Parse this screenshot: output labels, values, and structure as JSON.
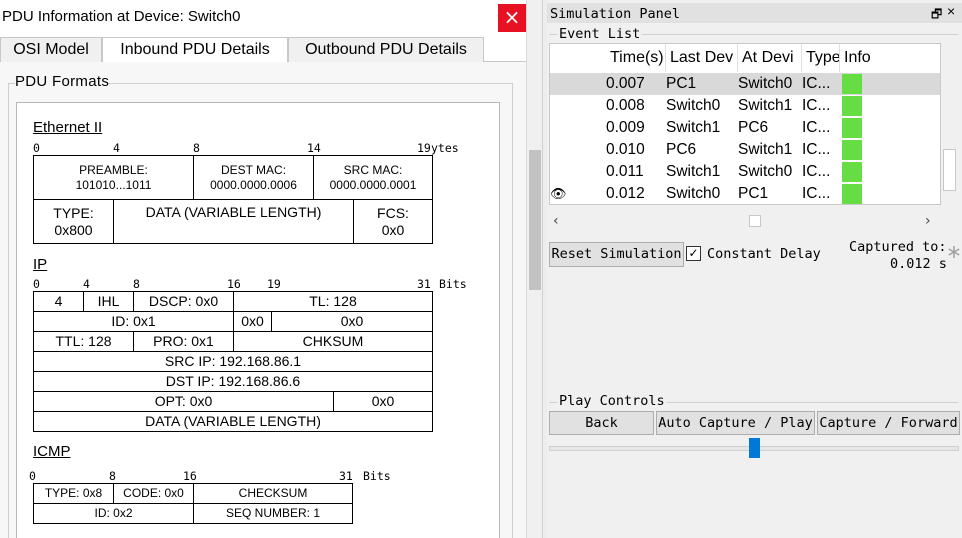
{
  "pdu_window": {
    "title": "PDU Information at Device: Switch0",
    "close_glyph": "×",
    "tabs": [
      "OSI Model",
      "Inbound PDU Details",
      "Outbound PDU Details"
    ],
    "active_tab": "Inbound PDU Details",
    "fieldset_legend": "PDU Formats"
  },
  "ethernet": {
    "title": "Ethernet II",
    "ticks": [
      "0",
      "4",
      "8",
      "14",
      "19"
    ],
    "unit": "ytes",
    "preamble_label": "PREAMBLE:",
    "preamble_value": "101010...1011",
    "dest_mac_label": "DEST MAC:",
    "dest_mac_value": "0000.0000.0006",
    "src_mac_label": "SRC MAC:",
    "src_mac_value": "0000.0000.0001",
    "type_label": "TYPE:",
    "type_value": "0x800",
    "data": "DATA (VARIABLE LENGTH)",
    "fcs_label": "FCS:",
    "fcs_value": "0x0"
  },
  "ip": {
    "title": "IP",
    "ticks": [
      "0",
      "4",
      "8",
      "16",
      "19",
      "31"
    ],
    "unit": "Bits",
    "version": "4",
    "ihl": "IHL",
    "dscp": "DSCP: 0x0",
    "tl": "TL: 128",
    "id": "ID: 0x1",
    "flags": "0x0",
    "frag": "0x0",
    "ttl": "TTL: 128",
    "pro": "PRO: 0x1",
    "chksum": "CHKSUM",
    "src_ip": "SRC IP: 192.168.86.1",
    "dst_ip": "DST IP: 192.168.86.6",
    "opt": "OPT: 0x0",
    "opt2": "0x0",
    "data": "DATA (VARIABLE LENGTH)"
  },
  "icmp": {
    "title": "ICMP",
    "ticks": [
      "0",
      "8",
      "16",
      "31"
    ],
    "unit": "Bits",
    "type": "TYPE: 0x8",
    "code": "CODE: 0x0",
    "checksum": "CHECKSUM",
    "id": "ID: 0x2",
    "seq": "SEQ NUMBER: 1"
  },
  "sim_panel": {
    "title": "Simulation Panel",
    "float_icon": "🗗",
    "close_icon": "×",
    "event_list_legend": "Event List",
    "columns": [
      "Time(s)",
      "Last Dev",
      "At Devi",
      "Type",
      "Info"
    ],
    "events": [
      {
        "time": "0.007",
        "last": "PC1",
        "at": "Switch0",
        "type": "IC...",
        "color": "#66dd44"
      },
      {
        "time": "0.008",
        "last": "Switch0",
        "at": "Switch1",
        "type": "IC...",
        "color": "#66dd44"
      },
      {
        "time": "0.009",
        "last": "Switch1",
        "at": "PC6",
        "type": "IC...",
        "color": "#66dd44"
      },
      {
        "time": "0.010",
        "last": "PC6",
        "at": "Switch1",
        "type": "IC...",
        "color": "#66dd44"
      },
      {
        "time": "0.011",
        "last": "Switch1",
        "at": "Switch0",
        "type": "IC...",
        "color": "#66dd44"
      },
      {
        "time": "0.012",
        "last": "Switch0",
        "at": "PC1",
        "type": "IC...",
        "color": "#66dd44"
      }
    ],
    "eye_glyph": "👁",
    "reset_label": "Reset Simulation",
    "constant_delay_label": "Constant Delay",
    "constant_delay_checked": "✓",
    "captured_label": "Captured to:",
    "captured_value": "0.012 s",
    "play_controls_legend": "Play Controls",
    "back_label": "Back",
    "auto_capture_label": "Auto Capture / Play",
    "capture_forward_label": "Capture / Forward",
    "accent": "#0078d7"
  }
}
